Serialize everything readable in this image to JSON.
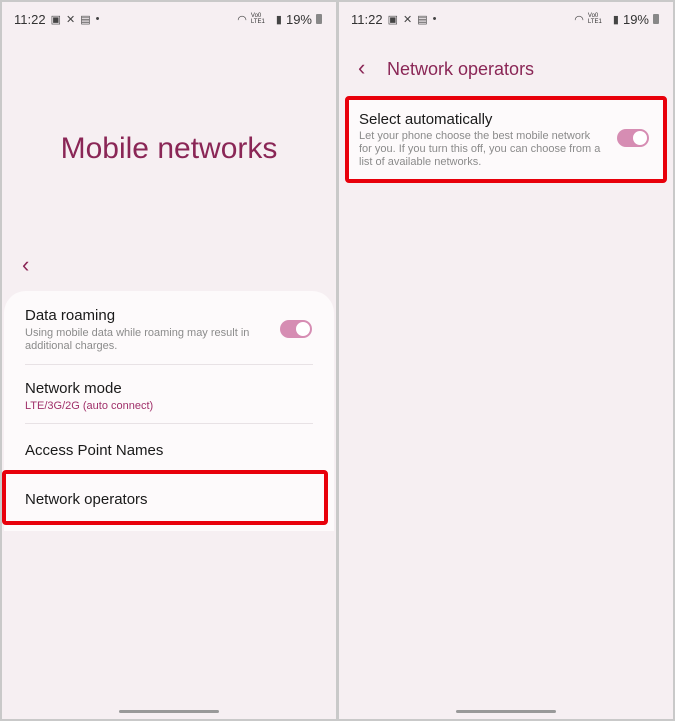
{
  "status": {
    "time": "11:22",
    "icons": [
      "gallery-icon",
      "missed-call-icon",
      "notes-icon",
      "dot-icon"
    ],
    "right_icons": [
      "wifi-icon",
      "volte-icon",
      "signal-icon"
    ],
    "volte": "Vo0 LTE1",
    "battery": "19%"
  },
  "left": {
    "title": "Mobile networks",
    "items": [
      {
        "title": "Data roaming",
        "desc": "Using mobile data while roaming may result in additional charges.",
        "toggle_on": true
      },
      {
        "title": "Network mode",
        "value": "LTE/3G/2G (auto connect)"
      },
      {
        "title": "Access Point Names"
      },
      {
        "title": "Network operators"
      }
    ]
  },
  "right": {
    "title": "Network operators",
    "item": {
      "title": "Select automatically",
      "desc": "Let your phone choose the best mobile network for you. If you turn this off, you can choose from a list of available networks.",
      "toggle_on": true
    }
  },
  "colors": {
    "accent": "#8a2656",
    "toggle": "#d68db3",
    "highlight": "#e8000b"
  }
}
